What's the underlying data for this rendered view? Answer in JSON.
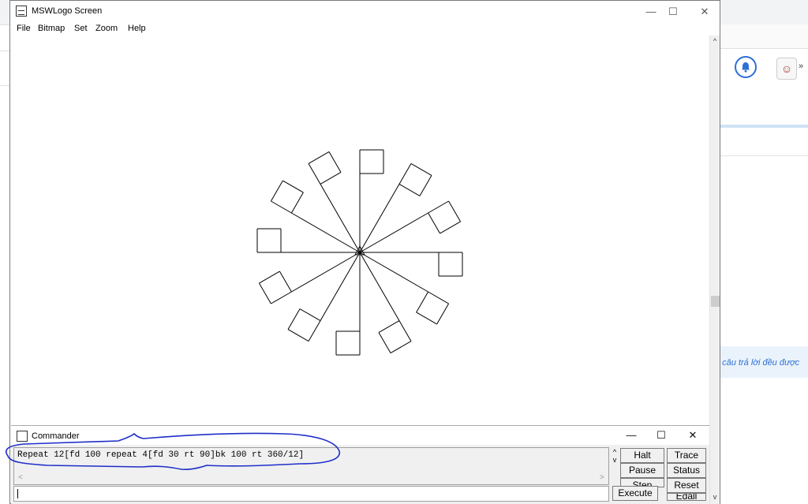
{
  "background": {
    "banner_text": "ả câu trả lời đều được"
  },
  "window": {
    "title": "MSWLogo Screen",
    "controls": {
      "minimize": "—",
      "maximize": "☐",
      "close": "✕"
    },
    "menu": [
      "File",
      "Bitmap",
      "Set",
      "Zoom",
      "Help"
    ]
  },
  "drawing": {
    "description_icon": "turtle-drawing",
    "repeat_count": 12,
    "forward": 100,
    "square_side": 30,
    "turn_degrees": 30
  },
  "commander": {
    "title": "Commander",
    "controls": {
      "minimize": "—",
      "maximize": "☐",
      "close": "✕"
    },
    "history": "Repeat 12[fd 100 repeat 4[fd 30 rt 90]bk 100 rt 360/12]",
    "input_value": "",
    "buttons": {
      "halt": "Halt",
      "trace": "Trace",
      "pause": "Pause",
      "status": "Status",
      "step": "Step",
      "reset": "Reset",
      "execute": "Execute",
      "edall": "Edall"
    }
  },
  "colors": {
    "annotation": "#1f2fc9",
    "accent": "#2d6fd6"
  }
}
